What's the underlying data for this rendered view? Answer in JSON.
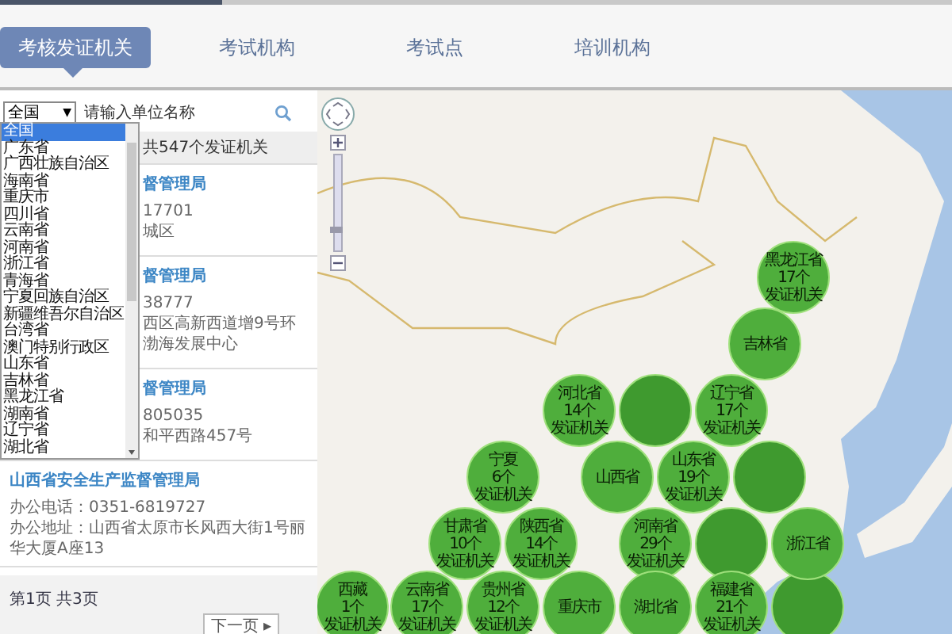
{
  "tabs": [
    {
      "label": "考核发证机关",
      "selected": true
    },
    {
      "label": "考试机构",
      "selected": false
    },
    {
      "label": "考试点",
      "selected": false
    },
    {
      "label": "培训机构",
      "selected": false
    }
  ],
  "search": {
    "region_select": "全国",
    "region_caret": "▼",
    "placeholder": "请输入单位名称"
  },
  "region_dropdown": {
    "expanded": true,
    "options": [
      {
        "label": "全国",
        "selected": true
      },
      {
        "label": "广东省",
        "selected": false
      },
      {
        "label": "广西壮族自治区",
        "selected": false
      },
      {
        "label": "海南省",
        "selected": false
      },
      {
        "label": "重庆市",
        "selected": false
      },
      {
        "label": "四川省",
        "selected": false
      },
      {
        "label": "云南省",
        "selected": false
      },
      {
        "label": "河南省",
        "selected": false
      },
      {
        "label": "浙江省",
        "selected": false
      },
      {
        "label": "青海省",
        "selected": false
      },
      {
        "label": "宁夏回族自治区",
        "selected": false
      },
      {
        "label": "新疆维吾尔自治区",
        "selected": false
      },
      {
        "label": "台湾省",
        "selected": false
      },
      {
        "label": "澳门特别行政区",
        "selected": false
      },
      {
        "label": "山东省",
        "selected": false
      },
      {
        "label": "吉林省",
        "selected": false
      },
      {
        "label": "黑龙江省",
        "selected": false
      },
      {
        "label": "湖南省",
        "selected": false
      },
      {
        "label": "辽宁省",
        "selected": false
      },
      {
        "label": "湖北省",
        "selected": false
      }
    ]
  },
  "result_count": "共547个发证机关",
  "results": [
    {
      "kind": "partial",
      "name": "督管理局",
      "phone": "17701",
      "address": "城区"
    },
    {
      "kind": "partial",
      "name": "督管理局",
      "phone": "38777",
      "address": "西区高新西道增9号环渤海发展中心"
    },
    {
      "kind": "partial",
      "name": "督管理局",
      "phone": "805035",
      "address": "和平西路457号"
    },
    {
      "kind": "full",
      "name": "山西省安全生产监督管理局",
      "phone": "办公电话：0351-6819727",
      "address": "办公地址：山西省太原市长风西大街1号丽华大厦A座13"
    }
  ],
  "pagination": {
    "page_info": "第1页 共3页",
    "next": "下一页 ▸"
  },
  "map": {
    "zoom_slider": {
      "level": 0.2
    },
    "clusters": [
      {
        "kind": "labeled",
        "name": "黑龙江省",
        "count": "17个",
        "caption": "发证机关"
      },
      {
        "kind": "labeled",
        "name": "吉林省"
      },
      {
        "kind": "labeled",
        "name": "河北省",
        "count": "14个",
        "caption": "发证机关"
      },
      {
        "kind": "unlabeled"
      },
      {
        "kind": "labeled",
        "name": "辽宁省",
        "count": "17个",
        "caption": "发证机关"
      },
      {
        "kind": "labeled",
        "name": "宁夏",
        "count": "6个",
        "caption": "发证机关"
      },
      {
        "kind": "labeled",
        "name": "山西省"
      },
      {
        "kind": "labeled",
        "name": "山东省",
        "count": "19个",
        "caption": "发证机关"
      },
      {
        "kind": "unlabeled"
      },
      {
        "kind": "labeled",
        "name": "甘肃省",
        "count": "10个",
        "caption": "发证机关"
      },
      {
        "kind": "labeled",
        "name": "陕西省",
        "count": "14个",
        "caption": "发证机关"
      },
      {
        "kind": "labeled",
        "name": "河南省",
        "count": "29个",
        "caption": "发证机关"
      },
      {
        "kind": "unlabeled"
      },
      {
        "kind": "labeled",
        "name": "浙江省"
      },
      {
        "kind": "labeled",
        "name": "西藏",
        "count": "1个",
        "caption": "发证机关"
      },
      {
        "kind": "labeled",
        "name": "云南省",
        "count": "17个",
        "caption": "发证机关"
      },
      {
        "kind": "labeled",
        "name": "贵州省",
        "count": "12个",
        "caption": "发证机关"
      },
      {
        "kind": "labeled",
        "name": "重庆市"
      },
      {
        "kind": "labeled",
        "name": "湖北省"
      },
      {
        "kind": "labeled",
        "name": "福建省",
        "count": "21个",
        "caption": "发证机关"
      },
      {
        "kind": "unlabeled"
      }
    ]
  }
}
